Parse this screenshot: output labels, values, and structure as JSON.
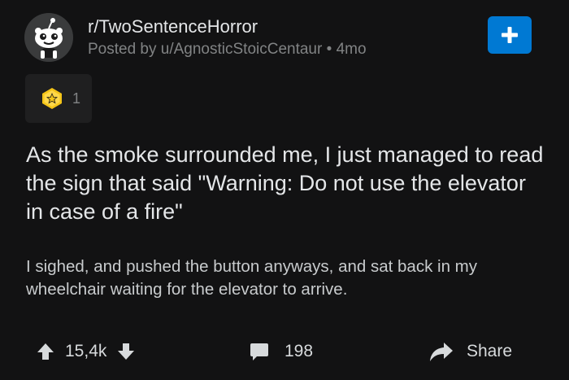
{
  "header": {
    "subreddit": "r/TwoSentenceHorror",
    "posted_by": "Posted by u/AgnosticStoicCentaur",
    "separator": "•",
    "age": "4mo",
    "avatar_icon": "snoo-avatar-icon",
    "join_icon": "plus-icon"
  },
  "award": {
    "icon": "award-star-icon",
    "count": "1"
  },
  "post": {
    "title": "As the smoke surrounded me, I just managed to read the sign that said \"Warning: Do not use the elevator in case of a fire\"",
    "body": "I sighed, and pushed the button anyways, and sat back in my wheelchair waiting for the elevator to arrive."
  },
  "actions": {
    "score": "15,4k",
    "comments": "198",
    "share_label": "Share"
  },
  "colors": {
    "background": "#121213",
    "accent": "#0079d3",
    "award_gold": "#f5c518"
  }
}
